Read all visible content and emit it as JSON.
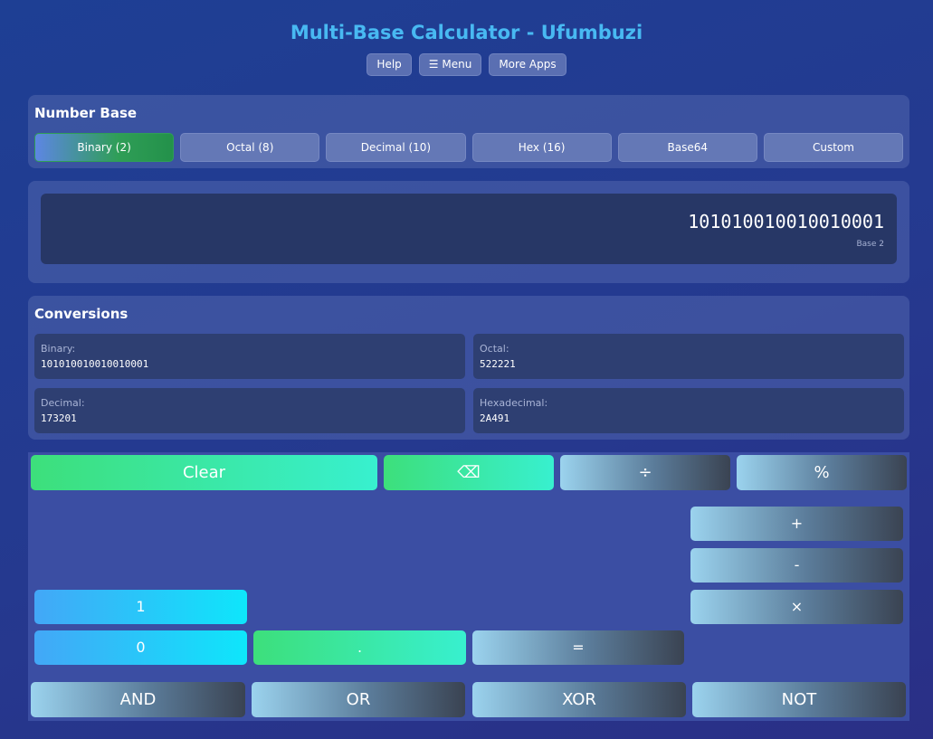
{
  "header": {
    "title": "Multi-Base Calculator - Ufumbuzi",
    "nav": [
      "Help",
      "☰ Menu",
      "More Apps"
    ]
  },
  "number_base": {
    "title": "Number Base",
    "options": [
      "Binary (2)",
      "Octal (8)",
      "Decimal (10)",
      "Hex (16)",
      "Base64",
      "Custom"
    ],
    "selected": "Binary (2)"
  },
  "display": {
    "value": "101010010010010001",
    "base_label": "Base 2"
  },
  "conversions": {
    "title": "Conversions",
    "binary": {
      "label": "Binary:",
      "value": "101010010010010001"
    },
    "octal": {
      "label": "Octal:",
      "value": "522221"
    },
    "decimal": {
      "label": "Decimal:",
      "value": "173201"
    },
    "hexadecimal": {
      "label": "Hexadecimal:",
      "value": "2A491"
    }
  },
  "keypad": {
    "clear": "Clear",
    "backspace": "⌫",
    "divide": "÷",
    "percent": "%",
    "plus": "+",
    "minus": "-",
    "multiply": "×",
    "one": "1",
    "zero": "0",
    "dot": ".",
    "equals": "=",
    "and": "AND",
    "or": "OR",
    "xor": "XOR",
    "not": "NOT"
  },
  "colors": {
    "title": "#48b9f2",
    "active_base": "#2f9e57",
    "green_key": "#3ddf7b",
    "blue_key": "#43a7f7"
  }
}
